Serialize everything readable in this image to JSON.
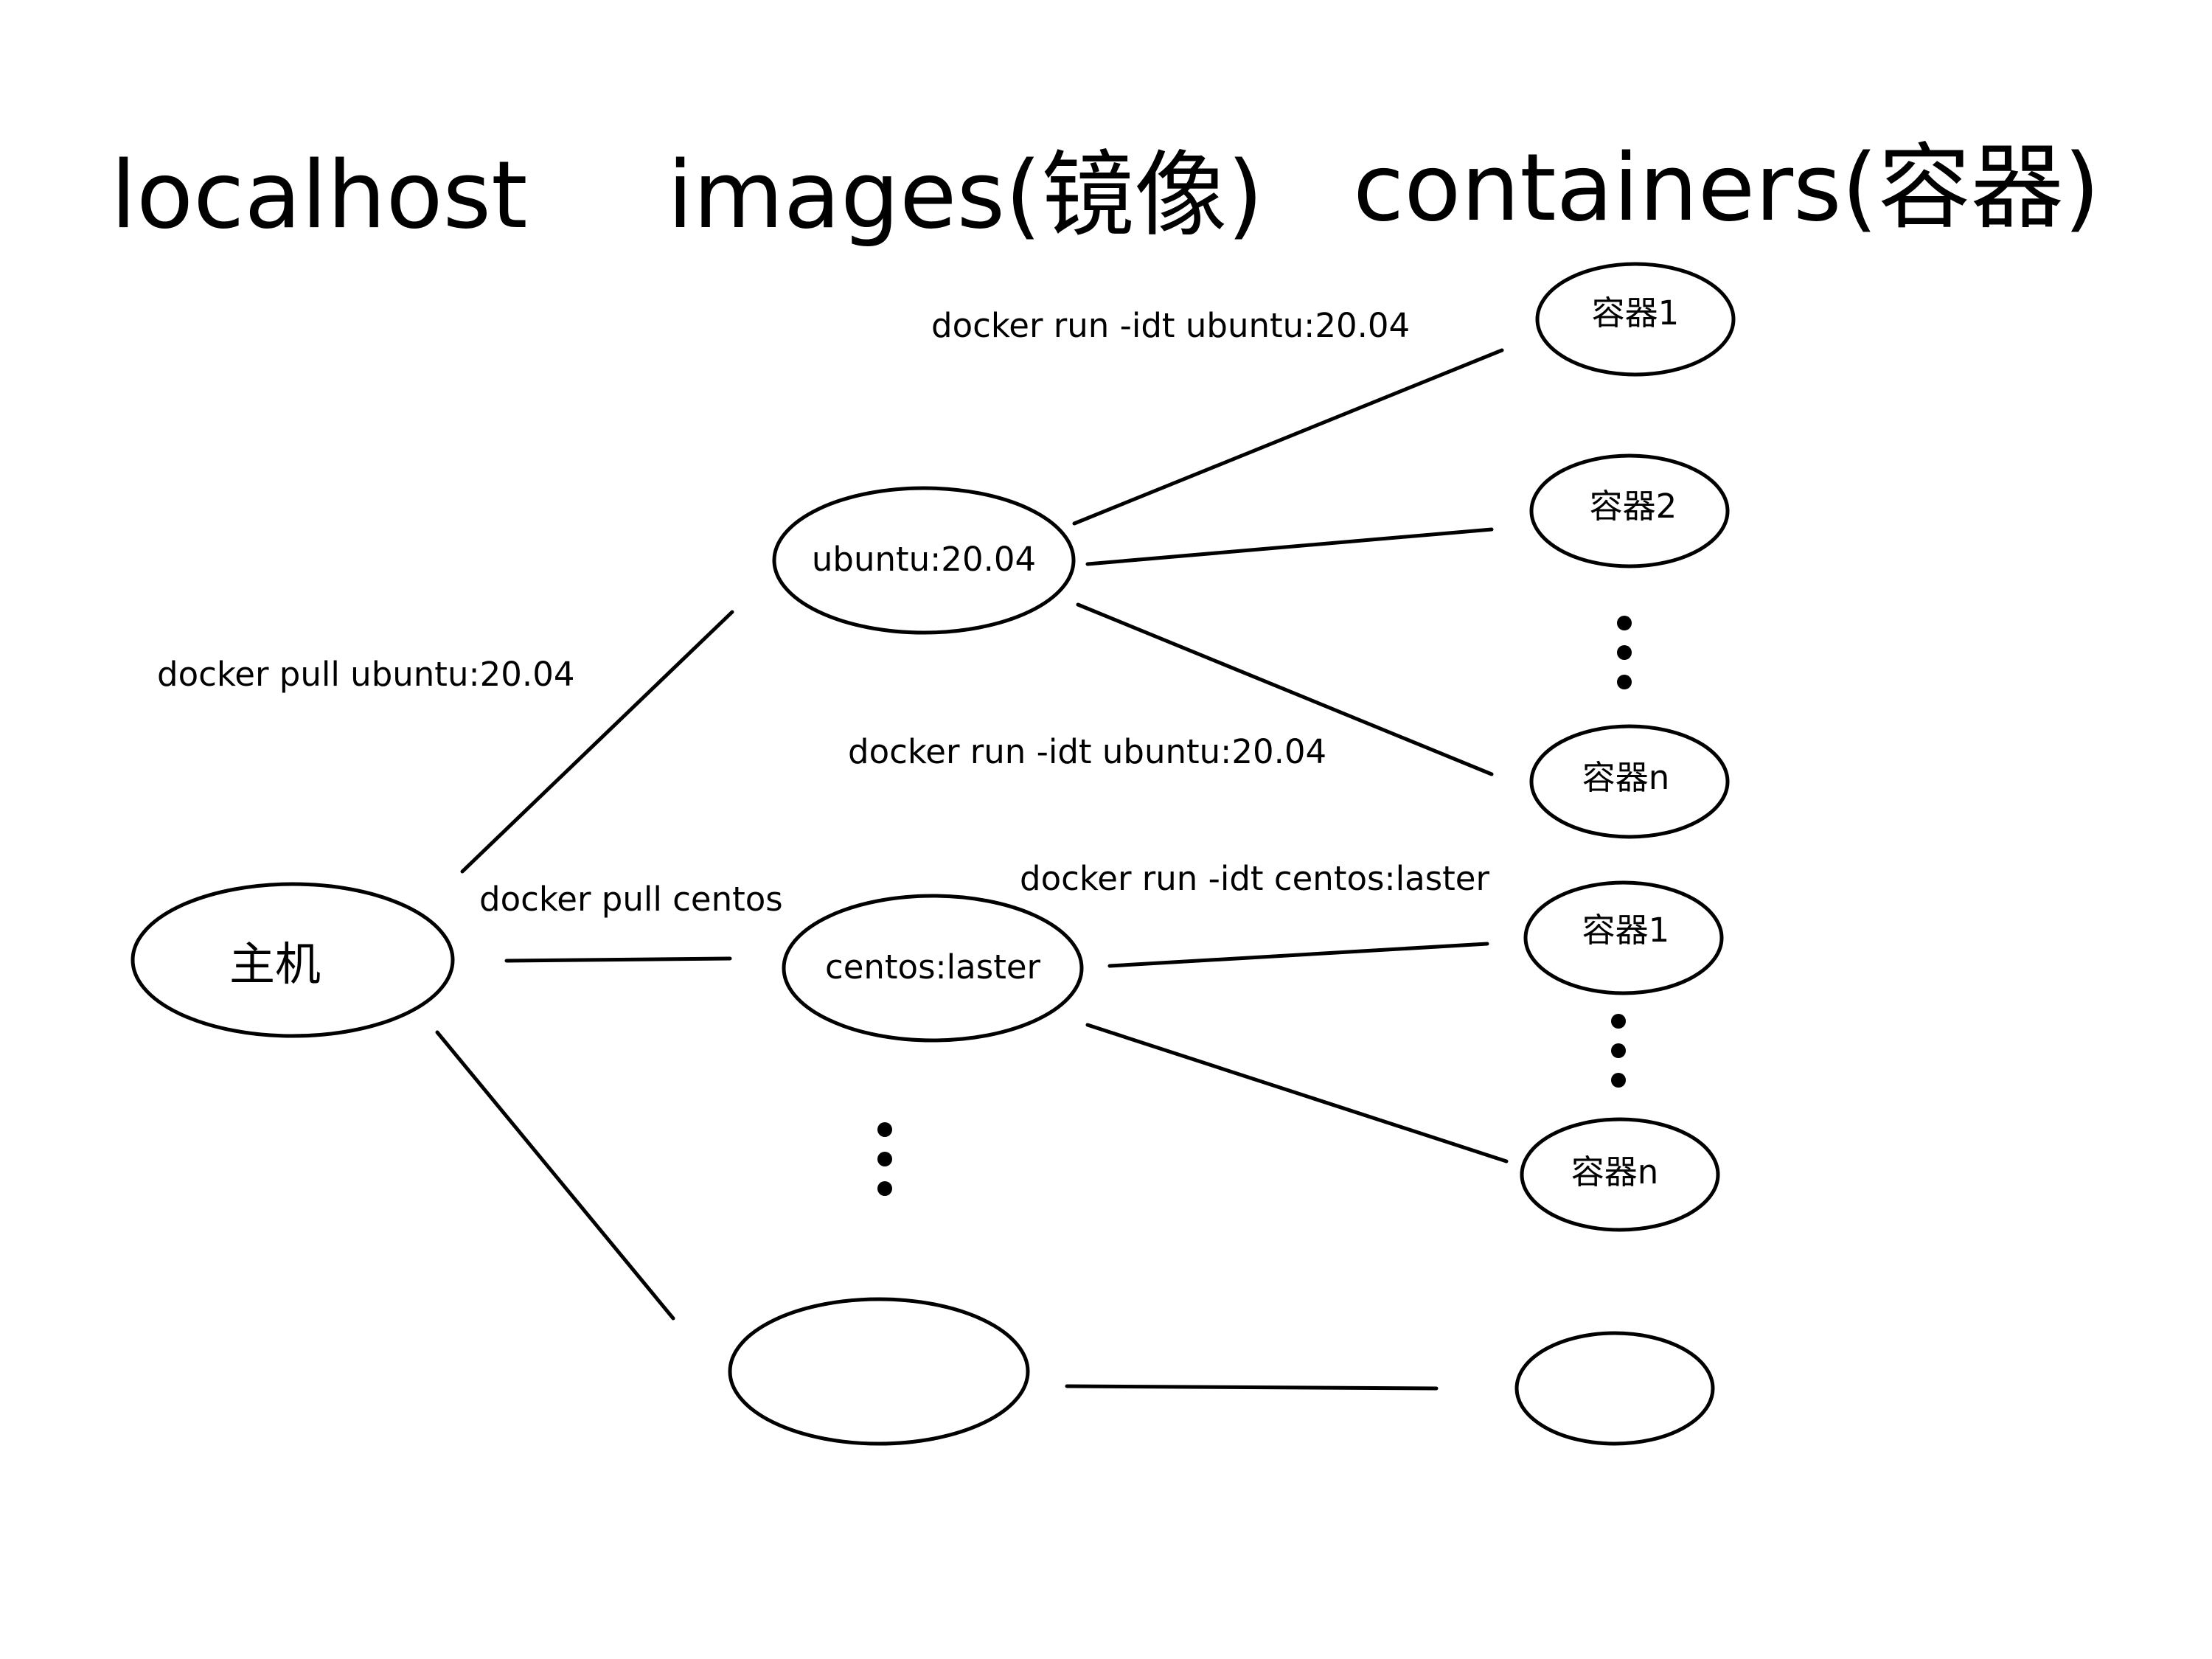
{
  "headers": {
    "localhost": "localhost",
    "images": "images(镜像)",
    "containers": "containers(容器)"
  },
  "nodes": {
    "host": "主机",
    "image_ubuntu": "ubuntu:20.04",
    "image_centos": "centos:laster",
    "image_empty": "",
    "ubuntu_container_1": "容器1",
    "ubuntu_container_2": "容器2",
    "ubuntu_container_n": "容器n",
    "centos_container_1": "容器1",
    "centos_container_n": "容器n",
    "empty_container": ""
  },
  "edge_labels": {
    "pull_ubuntu": "docker pull ubuntu:20.04",
    "pull_centos": "docker pull centos",
    "run_ubuntu_top": "docker run -idt ubuntu:20.04",
    "run_ubuntu_bottom": "docker run -idt ubuntu:20.04",
    "run_centos": "docker run -idt centos:laster"
  }
}
